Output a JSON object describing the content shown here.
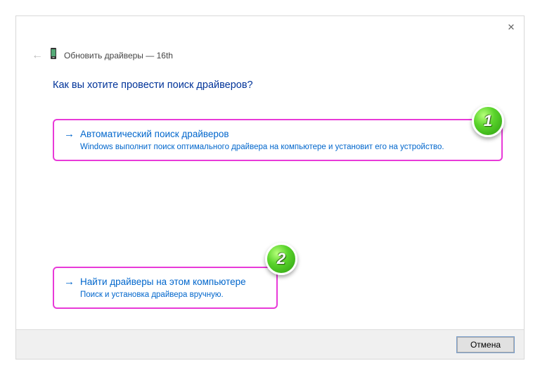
{
  "header": {
    "title": "Обновить драйверы — 16th"
  },
  "question": "Как вы хотите провести поиск драйверов?",
  "options": [
    {
      "title": "Автоматический поиск драйверов",
      "description": "Windows выполнит поиск оптимального драйвера на компьютере и установит его на устройство.",
      "badge": "1"
    },
    {
      "title": "Найти драйверы на этом компьютере",
      "description": "Поиск и установка драйвера вручную.",
      "badge": "2"
    }
  ],
  "footer": {
    "cancel": "Отмена"
  }
}
